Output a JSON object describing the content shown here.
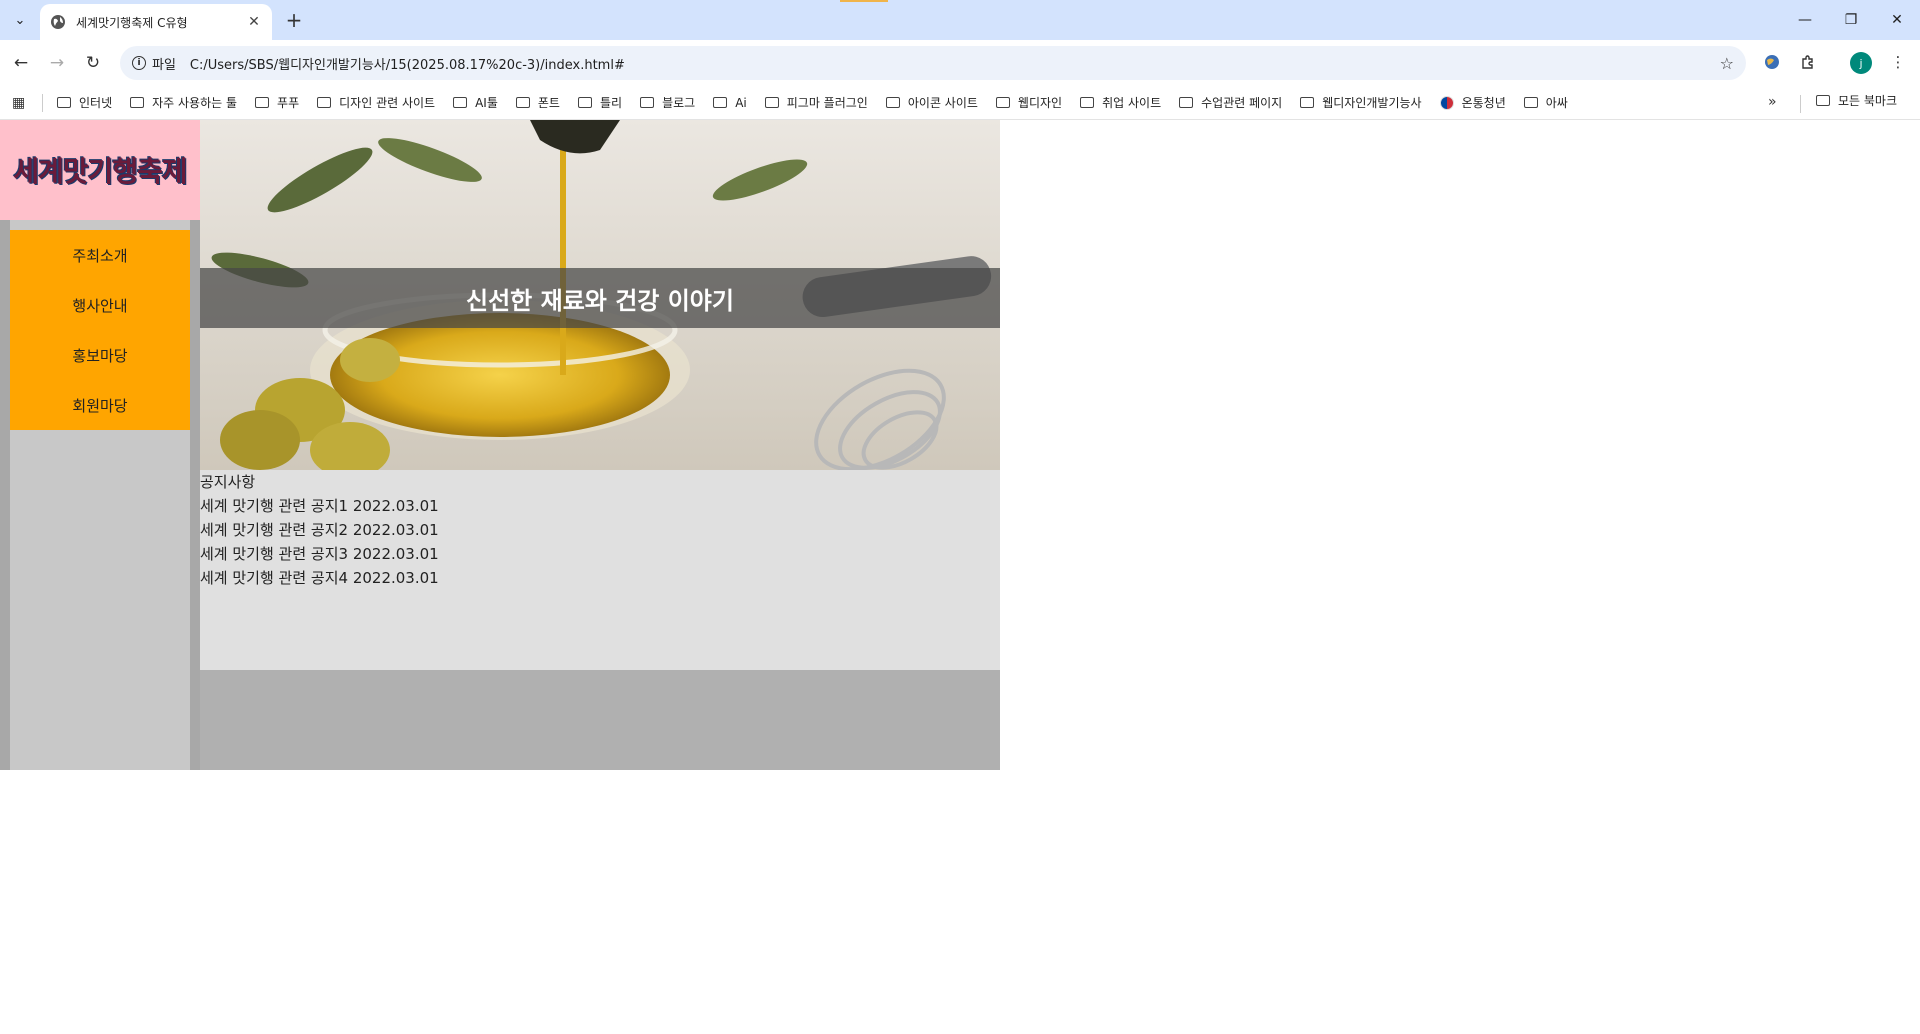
{
  "browser": {
    "tab_title": "세계맛기행축제 C유형",
    "omnibox_scheme": "파일",
    "url": "C:/Users/SBS/웹디자인개발기능사/15(2025.08.17%20c-3)/index.html#",
    "bookmarks": [
      "인터넷",
      "자주 사용하는 툴",
      "푸푸",
      "디자인 관련 사이트",
      "AI툴",
      "폰트",
      "틀리",
      "블로그",
      "Ai",
      "피그마 플러그인",
      "아이콘 사이트",
      "웹디자인",
      "취업 사이트",
      "수업관련 페이지",
      "웹디자인개발기능사",
      "온통청년",
      "아싸"
    ],
    "all_bookmarks": "모든 북마크",
    "profile_initial": "j"
  },
  "site": {
    "logo": "세계맛기행축제",
    "menu": [
      "주최소개",
      "행사안내",
      "홍보마당",
      "회원마당"
    ],
    "hero_caption": "신선한 재료와 건강 이야기",
    "notice": {
      "title": "공지사항",
      "items": [
        "세계 맛기행 관련 공지1 2022.03.01",
        "세계 맛기행 관련 공지2 2022.03.01",
        "세계 맛기행 관련 공지3 2022.03.01",
        "세계 맛기행 관련 공지4 2022.03.01"
      ]
    }
  },
  "colors": {
    "logo_bg": "#ffc0cb",
    "menu_bg": "#ffa500",
    "sidebar_bg": "#a8a8a8",
    "notice_bg": "#e0e0e0",
    "footer_bg": "#b0b0b0"
  }
}
